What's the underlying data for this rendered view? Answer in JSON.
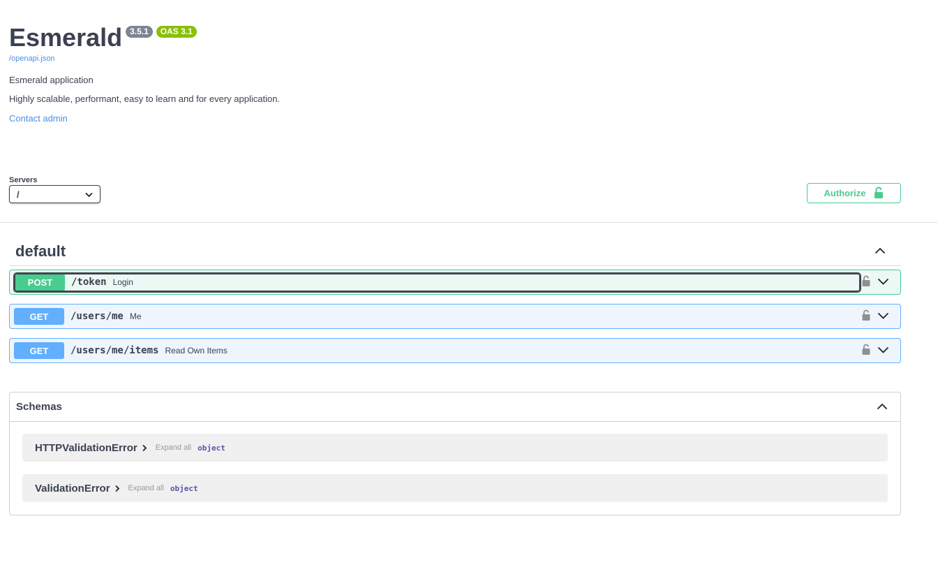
{
  "info": {
    "title": "Esmerald",
    "version_badge": "3.5.1",
    "oas_badge": "OAS 3.1",
    "spec_link": "/openapi.json",
    "description": "Esmerald application",
    "summary": "Highly scalable, performant, easy to learn and for every application.",
    "contact": "Contact admin"
  },
  "servers": {
    "label": "Servers",
    "selected": "/"
  },
  "authorize": {
    "label": "Authorize"
  },
  "tag": {
    "name": "default"
  },
  "operations": [
    {
      "method": "POST",
      "path": "/token",
      "summary": "Login"
    },
    {
      "method": "GET",
      "path": "/users/me",
      "summary": "Me"
    },
    {
      "method": "GET",
      "path": "/users/me/items",
      "summary": "Read Own Items"
    }
  ],
  "schemas": {
    "title": "Schemas",
    "models": [
      {
        "name": "HTTPValidationError",
        "expand": "Expand all",
        "type": "object"
      },
      {
        "name": "ValidationError",
        "expand": "Expand all",
        "type": "object"
      }
    ]
  },
  "colors": {
    "post": "#49cc90",
    "get": "#61affe",
    "link": "#4990e2",
    "oas_badge": "#89bf04",
    "version_badge": "#7d8492"
  }
}
